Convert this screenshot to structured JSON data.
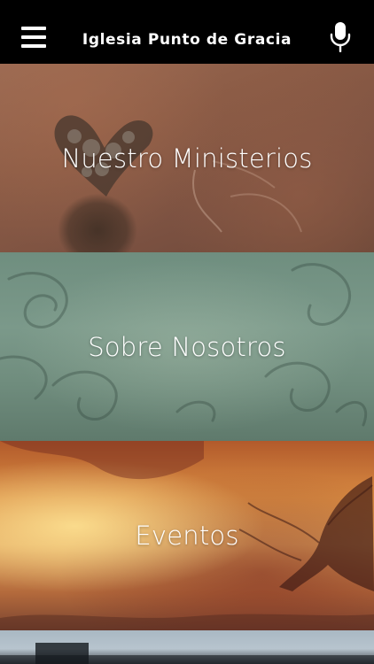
{
  "header": {
    "title": "Iglesia Punto de Gracia",
    "menu_icon": "hamburger-menu-icon",
    "mic_icon": "microphone-icon"
  },
  "tiles": [
    {
      "label": "Nuestro Ministerios"
    },
    {
      "label": "Sobre Nosotros"
    },
    {
      "label": "Eventos"
    },
    {
      "label": ""
    }
  ],
  "colors": {
    "header_bg": "#000000",
    "text": "#ffffff"
  }
}
